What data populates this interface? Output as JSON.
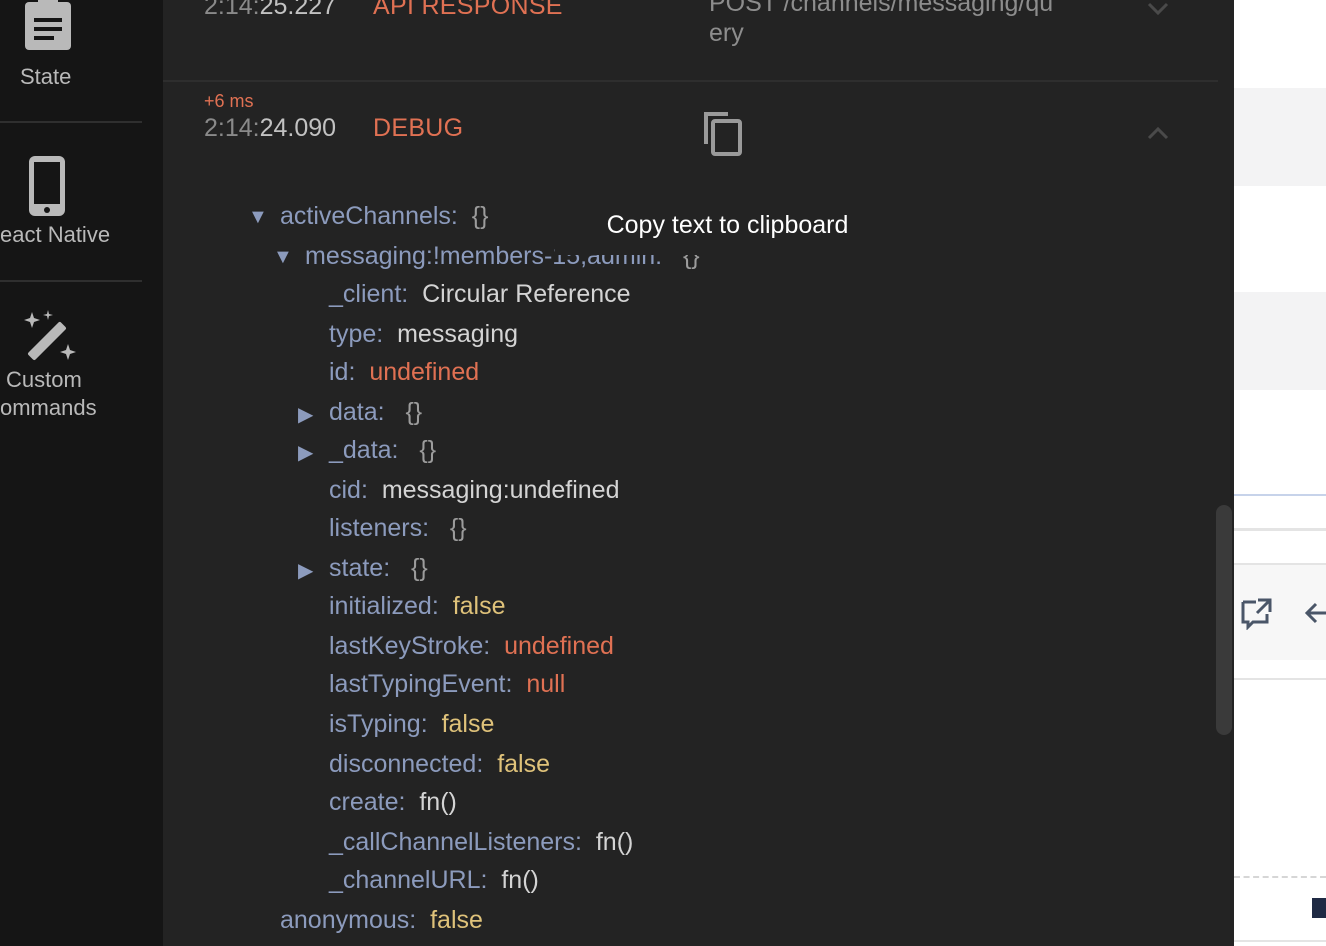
{
  "sidebar": {
    "items": [
      {
        "label": "State",
        "icon": "clipboard-icon"
      },
      {
        "label": "eact Native",
        "icon": "phone-icon"
      },
      {
        "label_line1": "Custom",
        "label_line2": "ommands",
        "icon": "magic-wand-icon"
      }
    ]
  },
  "log": {
    "prev_entry": {
      "time_dim": "2:14:",
      "time": "25.227",
      "tag": "API RESPONSE",
      "request_line1": "POST /channels/messaging/qu",
      "request_line2": "ery"
    },
    "entry": {
      "delta": "+6 ms",
      "time_dim": "2:14:",
      "time": "24.090",
      "tag": "DEBUG"
    }
  },
  "tooltip": {
    "text": "Copy text to clipboard"
  },
  "tree": {
    "activeChannels_key": "activeChannels:",
    "activeChannels_val": "{}",
    "messaging_key": "messaging:!members-15,admin:",
    "messaging_val": "{}",
    "rows": [
      {
        "key": "_client:",
        "val": "Circular Reference"
      },
      {
        "key": "type:",
        "val": "messaging"
      },
      {
        "key": "id:",
        "val": "undefined"
      },
      {
        "key": "data:",
        "val": "{}"
      },
      {
        "key": "_data:",
        "val": "{}"
      },
      {
        "key": "cid:",
        "val": "messaging:undefined"
      },
      {
        "key": "listeners:",
        "val": "{}"
      },
      {
        "key": "state:",
        "val": "{}"
      },
      {
        "key": "initialized:",
        "val": "false"
      },
      {
        "key": "lastKeyStroke:",
        "val": "undefined"
      },
      {
        "key": "lastTypingEvent:",
        "val": "null"
      },
      {
        "key": "isTyping:",
        "val": "false"
      },
      {
        "key": "disconnected:",
        "val": "false"
      },
      {
        "key": "create:",
        "val": "fn()"
      },
      {
        "key": "_callChannelListeners:",
        "val": "fn()"
      },
      {
        "key": "_channelURL:",
        "val": "fn()"
      }
    ],
    "anonymous_key": "anonymous:",
    "anonymous_val": "false",
    "expanded_marker": "▼",
    "collapsed_marker": "▶"
  },
  "colors": {
    "sidebar_bg": "#151515",
    "panel_bg": "#232323",
    "accent": "#e07153",
    "key": "#8c9bbd",
    "bool": "#dfc27a"
  }
}
